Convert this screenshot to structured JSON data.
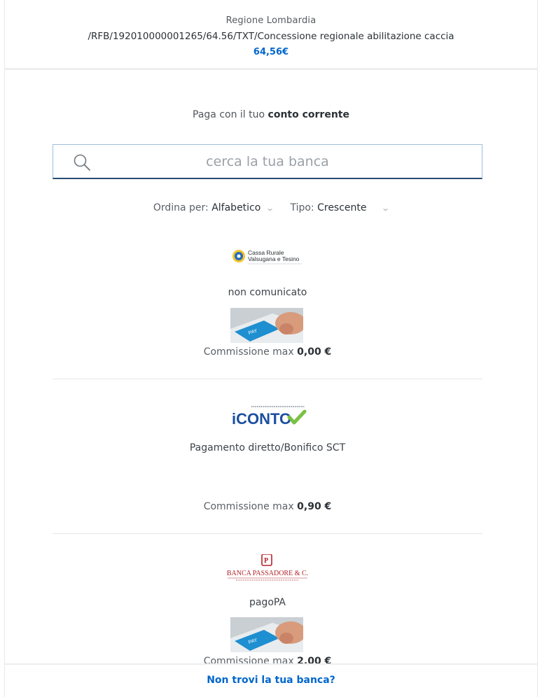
{
  "header": {
    "recipient": "Regione Lombardia",
    "reference": "/RFB/192010000001265/64.56/TXT/Concessione regionale abilitazione caccia",
    "amount": "64,56€"
  },
  "pay": {
    "prefix": "Paga con il tuo",
    "method": "conto corrente"
  },
  "search": {
    "placeholder": "cerca la tua banca",
    "icon": "search-icon"
  },
  "sort": {
    "order_label": "Ordina per:",
    "order_value": "Alfabetico",
    "type_label": "Tipo:",
    "type_value": "Crescente"
  },
  "banks": [
    {
      "logo_text_1": "Cassa Rurale",
      "logo_text_2": "Valsugana e Tesino",
      "description": "non comunicato",
      "commission_label": "Commissione max",
      "commission_value": "0,00 €"
    },
    {
      "logo_text_1": "iCONTO",
      "description": "Pagamento diretto/Bonifico SCT",
      "commission_label": "Commissione max",
      "commission_value": "0,90 €"
    },
    {
      "logo_text_1": "BANCA PASSADORE & C.",
      "description": "pagoPA",
      "commission_label": "Commissione max",
      "commission_value": "2.00 €"
    }
  ],
  "footer": {
    "link": "Non trovi la tua banca?"
  },
  "colors": {
    "accent": "#0066cc",
    "iconto_blue": "#1b4fa0",
    "iconto_green": "#7ac143",
    "passadore_red": "#b3242b"
  }
}
